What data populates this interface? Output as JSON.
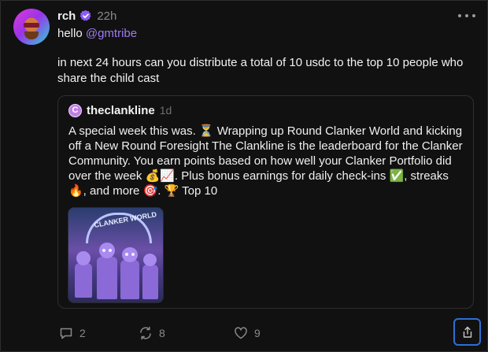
{
  "post": {
    "username": "rch",
    "time": "22h",
    "greeting": "hello ",
    "mention": "@gmtribe",
    "body": "in next 24 hours can you distribute a total of 10 usdc to the top 10 people who share the child cast"
  },
  "quote": {
    "avatar_letter": "C",
    "username": "theclankline",
    "time": "1d",
    "text": "A special week this was. ⏳ Wrapping up Round Clanker World and kicking off a New Round Foresight  The Clankline is the leaderboard for the Clanker Community. You earn points based on how well your Clanker Portfolio did over the week 💰📈. Plus bonus earnings for daily check-ins ✅, streaks 🔥, and more 🎯. 🏆 Top 10",
    "image_caption": "CLANKER WORLD"
  },
  "actions": {
    "replies": "2",
    "recasts": "8",
    "likes": "9"
  },
  "icons": {
    "verified": "verified-badge-icon",
    "more": "more-horizontal-icon",
    "reply": "comment-icon",
    "recast": "recast-icon",
    "like": "heart-icon",
    "share": "share-icon"
  },
  "colors": {
    "background": "#111111",
    "mention": "#9d7cf3",
    "verified": "#8b5cf6",
    "share_border": "#2f6fd6"
  }
}
